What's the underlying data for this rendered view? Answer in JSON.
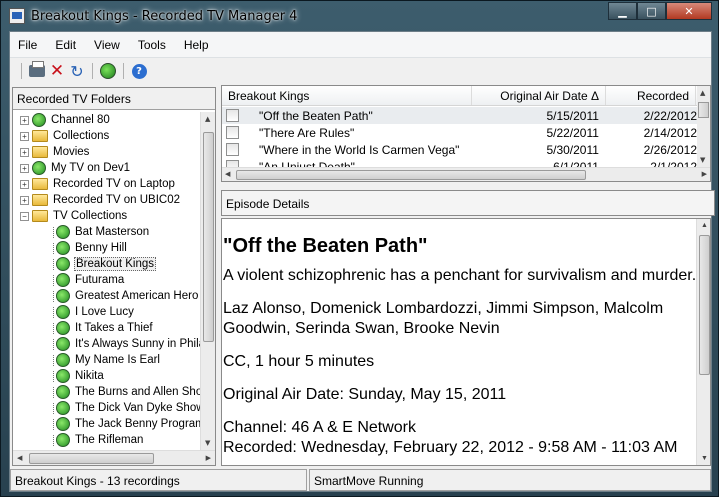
{
  "window": {
    "title": "Breakout Kings - Recorded TV Manager 4",
    "controls": {
      "minimize": "▁",
      "maximize": "□",
      "close": "✕"
    }
  },
  "menu": [
    "File",
    "Edit",
    "View",
    "Tools",
    "Help"
  ],
  "toolbar": {
    "icons": [
      "print-icon",
      "delete-icon",
      "refresh-icon",
      "media-center-icon",
      "help-icon"
    ],
    "help_glyph": "?"
  },
  "folders": {
    "header": "Recorded TV Folders",
    "items": [
      {
        "label": "Channel 80",
        "icon": "media-center",
        "level": 0,
        "expander": "+"
      },
      {
        "label": "Collections",
        "icon": "folder",
        "level": 0,
        "expander": "+"
      },
      {
        "label": "Movies",
        "icon": "folder",
        "level": 0,
        "expander": "+"
      },
      {
        "label": "My TV on Dev1",
        "icon": "media-center",
        "level": 0,
        "expander": "+"
      },
      {
        "label": "Recorded TV on Laptop",
        "icon": "folder",
        "level": 0,
        "expander": "+"
      },
      {
        "label": "Recorded TV on UBIC02",
        "icon": "folder",
        "level": 0,
        "expander": "+"
      },
      {
        "label": "TV Collections",
        "icon": "folder",
        "level": 0,
        "expander": "−"
      },
      {
        "label": "Bat Masterson",
        "icon": "show",
        "level": 1
      },
      {
        "label": "Benny Hill",
        "icon": "show",
        "level": 1
      },
      {
        "label": "Breakout Kings",
        "icon": "show",
        "level": 1,
        "selected": true
      },
      {
        "label": "Futurama",
        "icon": "show",
        "level": 1
      },
      {
        "label": "Greatest American Hero",
        "icon": "show",
        "level": 1
      },
      {
        "label": "I Love Lucy",
        "icon": "show",
        "level": 1
      },
      {
        "label": "It Takes a Thief",
        "icon": "show",
        "level": 1
      },
      {
        "label": "It's Always Sunny in Philadelphia",
        "icon": "show",
        "level": 1
      },
      {
        "label": "My Name Is Earl",
        "icon": "show",
        "level": 1
      },
      {
        "label": "Nikita",
        "icon": "show",
        "level": 1
      },
      {
        "label": "The Burns and Allen Show",
        "icon": "show",
        "level": 1
      },
      {
        "label": "The Dick Van Dyke Show",
        "icon": "show",
        "level": 1
      },
      {
        "label": "The Jack Benny Program",
        "icon": "show",
        "level": 1
      },
      {
        "label": "The Rifleman",
        "icon": "show",
        "level": 1
      }
    ]
  },
  "recordings": {
    "columns": [
      "Breakout Kings",
      "Original Air Date  Δ",
      "Recorded"
    ],
    "rows": [
      {
        "title": "\"Off the Beaten Path\"",
        "air_date": "5/15/2011",
        "recorded": "2/22/2012",
        "selected": true
      },
      {
        "title": "\"There Are Rules\"",
        "air_date": "5/22/2011",
        "recorded": "2/14/2012"
      },
      {
        "title": "\"Where in the World Is Carmen Vega\"",
        "air_date": "5/30/2011",
        "recorded": "2/26/2012"
      },
      {
        "title": "\"An Unjust Death\"",
        "air_date": "6/1/2011",
        "recorded": "2/1/2012"
      }
    ]
  },
  "details": {
    "header": "Episode Details",
    "title": "\"Off the Beaten Path\"",
    "synopsis": "A violent schizophrenic has a penchant for survivalism and murder.",
    "cast": "Laz Alonso, Domenick Lombardozzi, Jimmi Simpson, Malcolm Goodwin, Serinda Swan, Brooke Nevin",
    "info": "CC, 1 hour 5 minutes",
    "original_air_date": "Original Air Date: Sunday, May 15, 2011",
    "channel": "Channel: 46 A & E Network",
    "recorded": "Recorded: Wednesday, February 22, 2012 - 9:58 AM - 11:03 AM"
  },
  "status": {
    "left": "Breakout Kings - 13 recordings",
    "right": "SmartMove Running"
  }
}
